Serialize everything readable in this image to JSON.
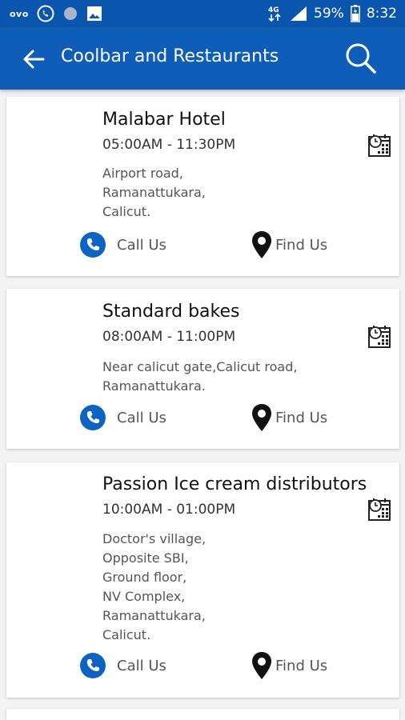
{
  "status_bar": {
    "carrier_label": "ovo",
    "network": "4G",
    "battery": "59%",
    "time": "8:32"
  },
  "app_bar": {
    "title": "Coolbar and Restaurants"
  },
  "restaurants": [
    {
      "name": "Malabar Hotel",
      "hours": "05:00AM - 11:30PM",
      "address": "Airport road,\nRamanattukara,\nCalicut.",
      "call_label": "Call Us",
      "find_label": "Find Us"
    },
    {
      "name": "Standard bakes",
      "hours": "08:00AM - 11:00PM",
      "address": "Near calicut gate,Calicut road,\nRamanattukara.",
      "call_label": "Call Us",
      "find_label": "Find Us"
    },
    {
      "name": "Passion Ice cream distributors",
      "hours": "10:00AM - 01:00PM",
      "address": "Doctor's village,\nOpposite SBI,\nGround floor,\nNV Complex,\nRamanattukara,\nCalicut.",
      "call_label": "Call Us",
      "find_label": "Find Us"
    }
  ],
  "colors": {
    "primary": "#0d5db9",
    "status_bar": "#0a55ae",
    "call_icon": "#0b63c4"
  }
}
